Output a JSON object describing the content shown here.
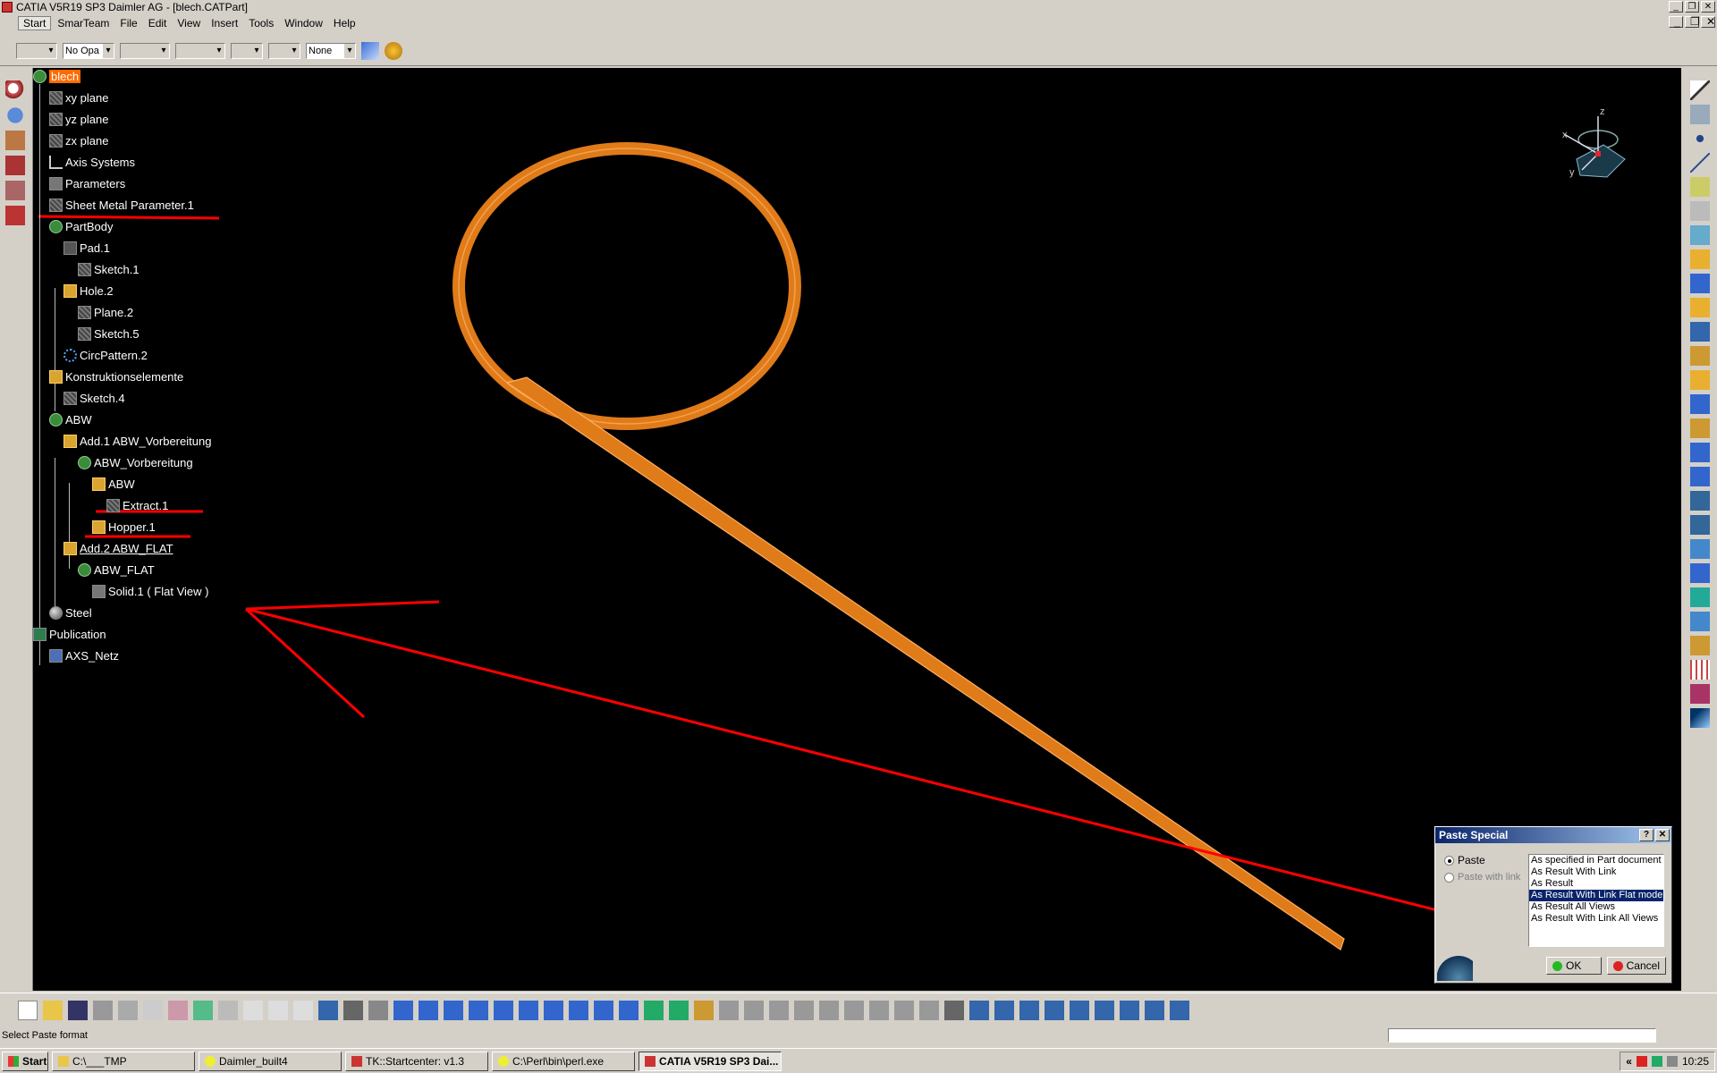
{
  "window": {
    "title": "CATIA V5R19 SP3 Daimler AG - [blech.CATPart]",
    "buttons": [
      "_",
      "❐",
      "✕"
    ]
  },
  "menu": [
    "Start",
    "SmarTeam",
    "File",
    "Edit",
    "View",
    "Insert",
    "Tools",
    "Window",
    "Help"
  ],
  "graphic_props": {
    "fill": "",
    "opacity": "No Opa",
    "line_type": "",
    "thickness": "",
    "layer": "None"
  },
  "tree": {
    "root": "blech",
    "items": [
      "xy plane",
      "yz plane",
      "zx plane",
      "Axis Systems",
      "Parameters",
      "Sheet Metal Parameter.1",
      "PartBody",
      "Pad.1",
      "Sketch.1",
      "Hole.2",
      "Plane.2",
      "Sketch.5",
      "CircPattern.2",
      "Konstruktionselemente",
      "Sketch.4",
      "ABW",
      "Add.1   ABW_Vorbereitung",
      "ABW_Vorbereitung",
      "ABW",
      "Extract.1",
      "Hopper.1",
      "Add.2   ABW_FLAT",
      "ABW_FLAT",
      "Solid.1 ( Flat View )",
      "Steel",
      "Publication",
      "AXS_Netz"
    ]
  },
  "compass": {
    "x": "x",
    "y": "y",
    "z": "z"
  },
  "dialog": {
    "title": "Paste Special",
    "help": "?",
    "close": "✕",
    "radio_paste": "Paste",
    "radio_paste_with_link": "Paste with link",
    "options": [
      "As specified in Part document",
      "As Result With Link",
      "As Result",
      "As Result With Link Flat mode",
      "As Result All Views",
      "As Result With Link All Views"
    ],
    "selected_option": "As Result With Link Flat mode",
    "ok": "OK",
    "cancel": "Cancel"
  },
  "status": {
    "message": "Select Paste format"
  },
  "taskbar": {
    "start": "Start",
    "items": [
      "C:\\___TMP",
      "Daimler_built4",
      "TK::Startcenter:  v1.3",
      "C:\\Perl\\bin\\perl.exe",
      "CATIA V5R19 SP3 Dai..."
    ],
    "clock": "10:25"
  },
  "colors": {
    "viewport_bg": "#000000",
    "part": "#e07b1a",
    "annotation": "#ff0000",
    "selection": "#ff6a00"
  }
}
